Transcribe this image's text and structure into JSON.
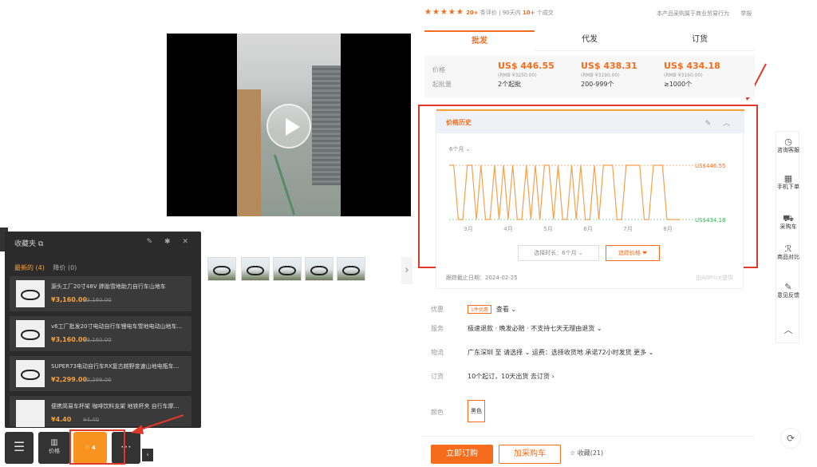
{
  "rating": {
    "stars": "★★★★★",
    "reviews_count": "20+",
    "reviews_label": "条评价",
    "period": "90天内",
    "sold_count": "10+",
    "sold_label": "个成交"
  },
  "top_right": {
    "text": "本产品采购属于商业贸易行为",
    "link": "举报"
  },
  "price_tabs": [
    "批发",
    "代发",
    "订货"
  ],
  "price_labels": {
    "price": "价格",
    "moq": "起批量"
  },
  "tiers": [
    {
      "usd": "US$ 446.55",
      "rmb": "(RMB ¥3250.00)",
      "qty": "2个起批"
    },
    {
      "usd": "US$ 438.31",
      "rmb": "(RMB ¥3190.00)",
      "qty": "200-999个"
    },
    {
      "usd": "US$ 434.18",
      "rmb": "(RMB ¥3160.00)",
      "qty": "≥1000个"
    }
  ],
  "price_history": {
    "title": "价格历史",
    "period": "6个月 ⌄",
    "select_label": "选择时长：6个月  ⌄",
    "alert_label": "追踪价格 ❤",
    "updated": "跟踪截止日期：2024-02-25",
    "source": "由AliPrice提供"
  },
  "chart_data": {
    "type": "line",
    "x_ticks": [
      "3月",
      "4月",
      "5月",
      "6月",
      "7月",
      "8月"
    ],
    "y_labels": {
      "high": "US$446.55",
      "low": "US$434.18"
    },
    "ylim": [
      434.18,
      446.55
    ],
    "series": [
      {
        "values": [
          446.55,
          446.55,
          434.18,
          434.18,
          446.55,
          446.55,
          434.18,
          446.55,
          434.18,
          434.18,
          446.55,
          434.18,
          446.55,
          434.18,
          446.55,
          434.18,
          434.18,
          446.55,
          434.18,
          446.55,
          434.18,
          446.55,
          446.55,
          434.18,
          446.55,
          434.18,
          434.18,
          446.55,
          434.18,
          446.55,
          434.18,
          434.18,
          446.55,
          434.18,
          446.55,
          446.55,
          446.55,
          434.18,
          434.18,
          446.55,
          446.55,
          446.55,
          446.55,
          434.18,
          434.18,
          446.55,
          446.55,
          446.55,
          434.18,
          434.18,
          434.18,
          434.18
        ]
      }
    ]
  },
  "specs": {
    "promo_k": "优惠",
    "promo_tag": "1件优惠",
    "promo_link": "查看 ⌄",
    "service_k": "服务",
    "service_v": "极速退款 · 晚发必赔 · 不支持七天无理由退货 ⌄",
    "logistics_k": "物流",
    "logistics_v": "广东深圳 至 请选择 ⌄  运费：选择收货地    承诺72小时发货  更多 ⌄",
    "order_k": "订货",
    "order_v": "10个起订，10天出货    去订货 ›",
    "color_k": "颜色",
    "color_v": "黑色"
  },
  "actions": {
    "buy": "立即订购",
    "cart": "加采购车",
    "collect": "☆ 收藏(21)"
  },
  "right_sidebar": [
    {
      "icon": "◷",
      "label": "咨询客服"
    },
    {
      "icon": "▦",
      "label": "手机下单"
    },
    {
      "icon": "⛟",
      "label": "采购车"
    },
    {
      "icon": "ℛ",
      "label": "商品对比"
    },
    {
      "icon": "✎",
      "label": "意见反馈"
    },
    {
      "icon": "︿",
      "label": ""
    }
  ],
  "favorites": {
    "title": "收藏夹  ⧉",
    "header_icons": "✎ ✱ ✕",
    "tab_latest": "最新的 (4)",
    "tab_price": "降价 (0)",
    "items": [
      {
        "title": "源头工厂20寸48V 胖胎雪地助力自行车山地车",
        "price": "¥3,160.00",
        "old": "¥3,160.00"
      },
      {
        "title": "v6工厂批发20寸电动自行车锂电车雪地电动山地车...",
        "price": "¥3,160.00",
        "old": "¥3,160.00"
      },
      {
        "title": "SUPER73电动自行车RX复古越野变速山地电瓶车...",
        "price": "¥2,299.00",
        "old": "¥2,299.00"
      },
      {
        "title": "便携简易车杯架 咖啡饮料支架 地铁杯夹 自行车摩...",
        "price": "¥4.40",
        "old": "¥4.40"
      }
    ]
  },
  "bottom_bar": {
    "price_label": "价格",
    "fav_count": "♡ 4"
  }
}
